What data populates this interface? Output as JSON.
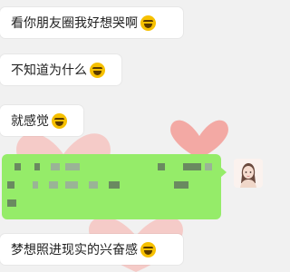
{
  "chat": {
    "messages": [
      {
        "text": "看你朋友圈我好想哭啊",
        "emoji": "sob-emoji"
      },
      {
        "text": "不知道为什么",
        "emoji": "sob-emoji"
      },
      {
        "text": "就感觉",
        "emoji": "sob-emoji"
      },
      {
        "text": "梦想照进现实的兴奋感",
        "emoji": "sob-emoji"
      }
    ],
    "own_message": {
      "type": "pixelated-redacted",
      "color": "#95ec69"
    }
  },
  "colors": {
    "bubble_incoming": "#ffffff",
    "bubble_outgoing": "#95ec69",
    "background_heart": "#f3a9a4"
  }
}
